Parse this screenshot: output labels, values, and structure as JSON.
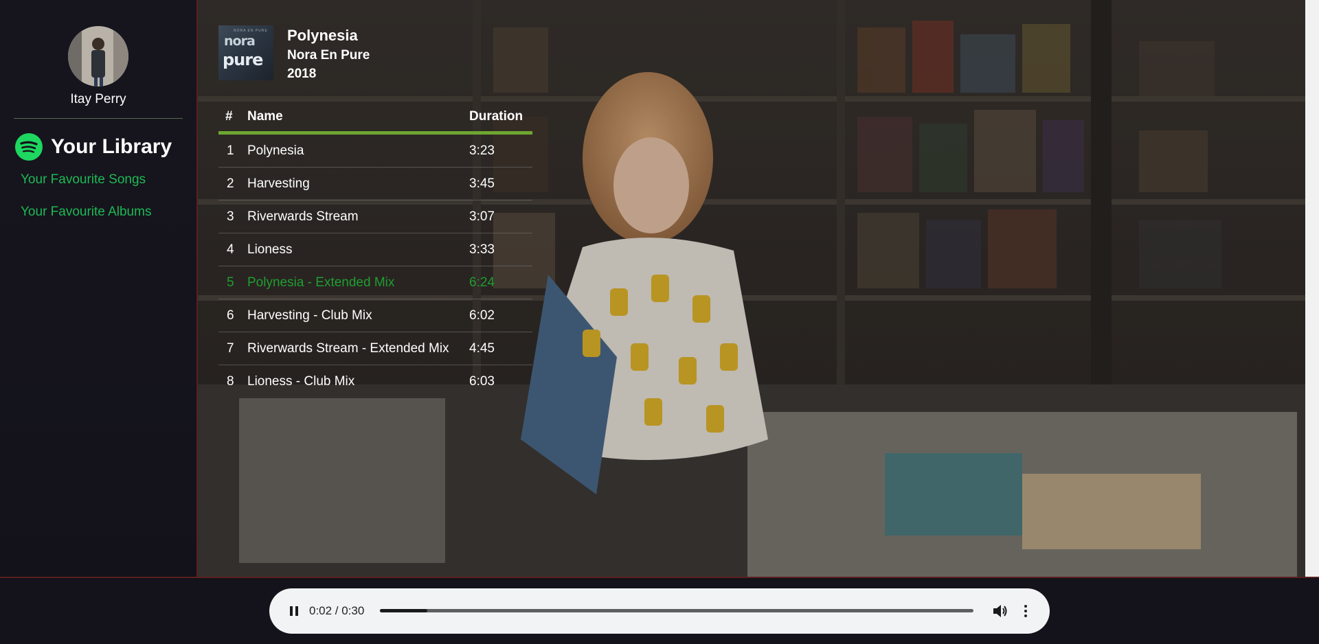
{
  "user": {
    "name": "Itay Perry"
  },
  "library": {
    "title": "Your Library",
    "links": [
      {
        "label": "Your Favourite Songs"
      },
      {
        "label": "Your Favourite Albums"
      }
    ]
  },
  "album": {
    "cover_text_top": "nora",
    "cover_text_bottom": "pure",
    "cover_text_tiny": "NORA EN PURE",
    "title": "Polynesia",
    "artist": "Nora En Pure",
    "year": "2018"
  },
  "tracks": {
    "headers": {
      "num": "#",
      "name": "Name",
      "duration": "Duration"
    },
    "rows": [
      {
        "num": "1",
        "name": "Polynesia",
        "duration": "3:23"
      },
      {
        "num": "2",
        "name": "Harvesting",
        "duration": "3:45"
      },
      {
        "num": "3",
        "name": "Riverwards Stream",
        "duration": "3:07"
      },
      {
        "num": "4",
        "name": "Lioness",
        "duration": "3:33"
      },
      {
        "num": "5",
        "name": "Polynesia - Extended Mix",
        "duration": "6:24"
      },
      {
        "num": "6",
        "name": "Harvesting - Club Mix",
        "duration": "6:02"
      },
      {
        "num": "7",
        "name": "Riverwards Stream - Extended Mix",
        "duration": "4:45"
      },
      {
        "num": "8",
        "name": "Lioness - Club Mix",
        "duration": "6:03"
      }
    ],
    "active_index": 4
  },
  "player": {
    "state_icon": "pause-icon",
    "time": "0:02 / 0:30",
    "progress": 0.08,
    "volume_icon": "volume-icon",
    "more_icon": "more-vertical-icon"
  },
  "colors": {
    "accent_green": "#1db954",
    "active_track": "#1f9e30",
    "header_underline": "#6ea631",
    "sidebar_bg": "#16151e"
  }
}
